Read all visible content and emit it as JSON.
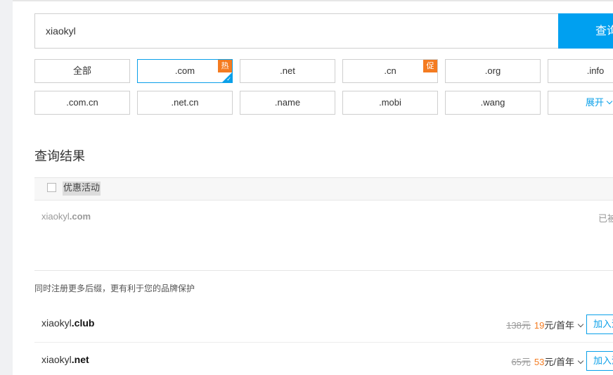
{
  "search": {
    "value": "xiaokyl",
    "button_label": "查询"
  },
  "suffixes": [
    {
      "label": "全部"
    },
    {
      "label": ".com",
      "badge": "热",
      "selected": true
    },
    {
      "label": ".net"
    },
    {
      "label": ".cn",
      "badge": "促"
    },
    {
      "label": ".org"
    },
    {
      "label": ".info"
    },
    {
      "label": ".com.cn"
    },
    {
      "label": ".net.cn"
    },
    {
      "label": ".name"
    },
    {
      "label": ".mobi"
    },
    {
      "label": ".wang"
    }
  ],
  "expand_label": "展开",
  "results": {
    "title": "查询结果",
    "promo_label": "优惠活动",
    "main": {
      "prefix": "xiaokyl",
      "suffix": ".com",
      "status": "已被注册"
    }
  },
  "suggestions": {
    "title": "同时注册更多后缀，更有利于您的品牌保护",
    "items": [
      {
        "prefix": "xiaokyl",
        "suffix": ".club",
        "old_price": "138元",
        "new_price": "19",
        "unit": "元/首年",
        "add_label": "加入清单"
      },
      {
        "prefix": "xiaokyl",
        "suffix": ".net",
        "old_price": "65元",
        "new_price": "53",
        "unit": "元/首年",
        "add_label": "加入清单"
      }
    ]
  },
  "colors": {
    "accent": "#00a0f0",
    "badge": "#f47b20",
    "price": "#f47b20"
  }
}
